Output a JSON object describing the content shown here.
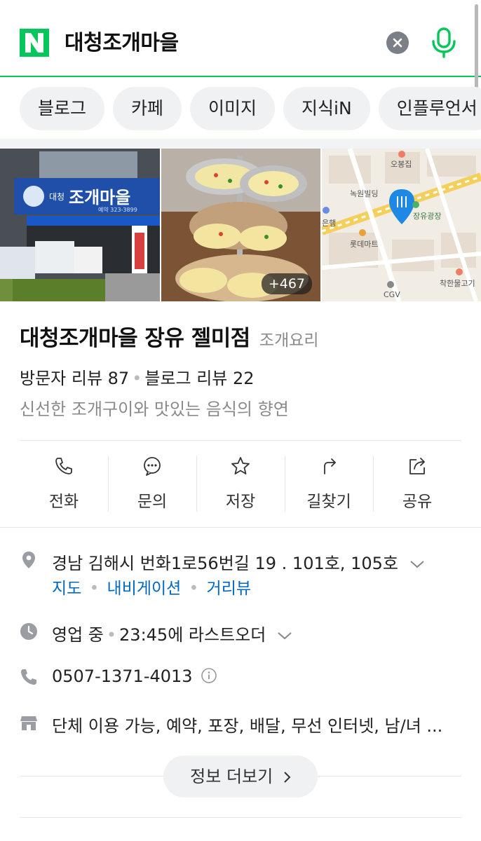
{
  "search": {
    "query": "대청조개마을"
  },
  "chips": [
    "블로그",
    "카페",
    "이미지",
    "지식iN",
    "인플루언서"
  ],
  "photos": {
    "sign_text": "대청 조개마을",
    "sign_phone": "예약 323-3899",
    "more_count": "+467",
    "map_labels": [
      "오봉집",
      "녹원빌딩",
      "장유광장",
      "롯데마트",
      "CGV",
      "착한물고기",
      "은행"
    ]
  },
  "place": {
    "name": "대청조개마을 장유 젤미점",
    "category": "조개요리",
    "visitor_reviews": "방문자 리뷰 87",
    "blog_reviews": "블로그 리뷰 22",
    "tagline": "신선한 조개구이와 맛있는 음식의 향연"
  },
  "actions": [
    "전화",
    "문의",
    "저장",
    "길찾기",
    "공유"
  ],
  "info": {
    "address": "경남 김해시 번화1로56번길 19 . 101호, 105호",
    "links": [
      "지도",
      "내비게이션",
      "거리뷰"
    ],
    "status": "영업 중",
    "last_order": "23:45에 라스트오더",
    "phone": "0507-1371-4013",
    "amenities": "단체 이용 가능, 예약, 포장, 배달, 무선 인터넷, 남/녀 ..."
  },
  "more_button": "정보 더보기",
  "colors": {
    "brand_green": "#03c75a",
    "link_blue": "#0068c3",
    "map_pin": "#1e88e5"
  }
}
